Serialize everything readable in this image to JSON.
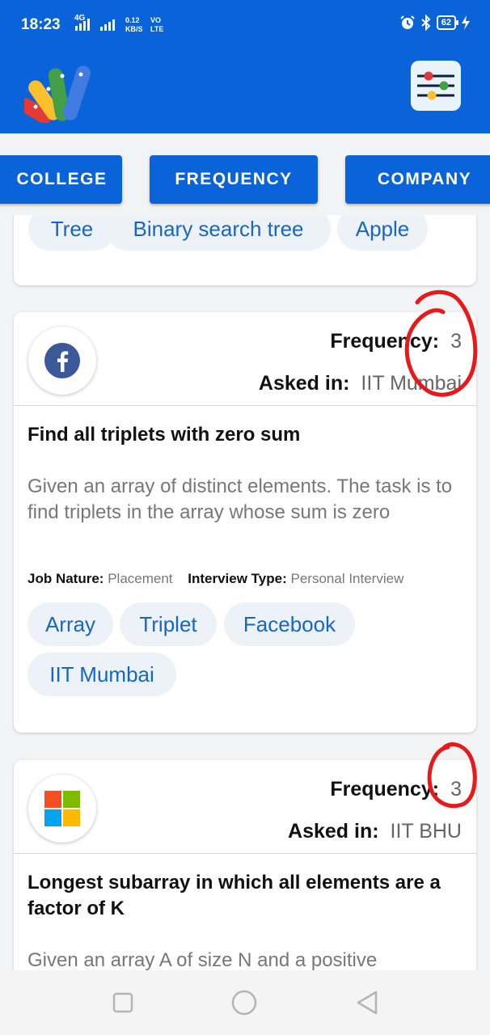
{
  "status_bar": {
    "time": "18:23",
    "network": "4G",
    "speed_value": "0.12",
    "speed_unit": "KB/S",
    "volte_top": "VO",
    "volte_bottom": "LTE",
    "battery": "62",
    "icons": [
      "alarm-icon",
      "bluetooth-icon",
      "charging-icon"
    ]
  },
  "app_bar": {
    "logo_icon": "peacock-fan-logo",
    "filter_icon": "sliders-icon",
    "accent": "#0a63d8"
  },
  "tabs": [
    {
      "label": "COLLEGE"
    },
    {
      "label": "FREQUENCY"
    },
    {
      "label": "COMPANY"
    }
  ],
  "prev_card": {
    "chips": [
      "Tree",
      "Binary search tree",
      "Apple"
    ]
  },
  "cards": [
    {
      "company_icon": "facebook-icon",
      "frequency_label": "Frequency:",
      "frequency_value": "3",
      "asked_label": "Asked in:",
      "asked_value": "IIT Mumbai",
      "title": "Find all triplets with zero sum",
      "description": "Given an array of distinct elements. The task is to find triplets in the array whose sum is zero",
      "job_nature_label": "Job Nature:",
      "job_nature_value": "Placement",
      "interview_type_label": "Interview Type:",
      "interview_type_value": "Personal Interview",
      "tags": [
        "Array",
        "Triplet",
        "Facebook",
        "IIT Mumbai"
      ]
    },
    {
      "company_icon": "microsoft-icon",
      "frequency_label": "Frequency:",
      "frequency_value": "3",
      "asked_label": "Asked in:",
      "asked_value": "IIT BHU",
      "title": "Longest subarray in which all elements are a factor of K",
      "description": "Given an array A of size N and a positive"
    }
  ],
  "nav_bar": {
    "icons": [
      "recents-square-icon",
      "home-circle-icon",
      "back-triangle-icon"
    ]
  },
  "annotation_color": "#e8191b"
}
